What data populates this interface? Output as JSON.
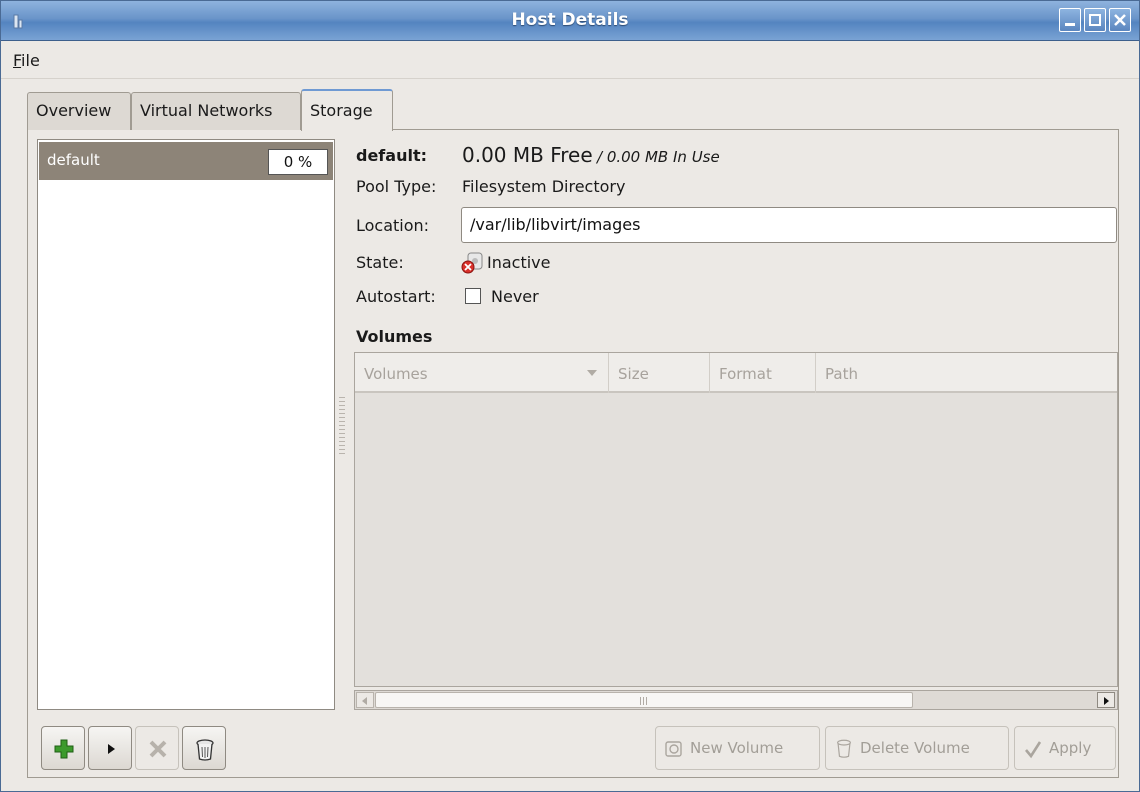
{
  "window": {
    "title": "Host Details"
  },
  "menu": {
    "file_first": "F",
    "file_rest": "ile"
  },
  "tabs": [
    {
      "label": "Overview"
    },
    {
      "label": "Virtual Networks"
    },
    {
      "label": "Storage"
    }
  ],
  "pools": [
    {
      "name": "default",
      "usage": "0 %"
    }
  ],
  "details": {
    "name": "default:",
    "free": "0.00 MB Free",
    "in_use": "/ 0.00 MB In Use",
    "pool_type_label": "Pool Type:",
    "pool_type": "Filesystem Directory",
    "location_label": "Location:",
    "location": "/var/lib/libvirt/images",
    "state_label": "State:",
    "state": "Inactive",
    "autostart_label": "Autostart:",
    "autostart": "Never",
    "volumes_title": "Volumes"
  },
  "volumes_table": {
    "columns": [
      "Volumes",
      "Size",
      "Format",
      "Path"
    ],
    "rows": []
  },
  "buttons": {
    "new_volume": "New Volume",
    "delete_volume": "Delete Volume",
    "apply": "Apply"
  },
  "icons": {
    "window": "app-icon",
    "add_pool": "plus-icon",
    "start_pool": "play-icon",
    "stop_pool": "stop-x-icon",
    "delete_pool": "trash-icon",
    "state": "inactive-disk-icon"
  },
  "colors": {
    "title_bar": "#5484c0",
    "selection": "#8d8478",
    "add_green": "#3c9a2c"
  }
}
